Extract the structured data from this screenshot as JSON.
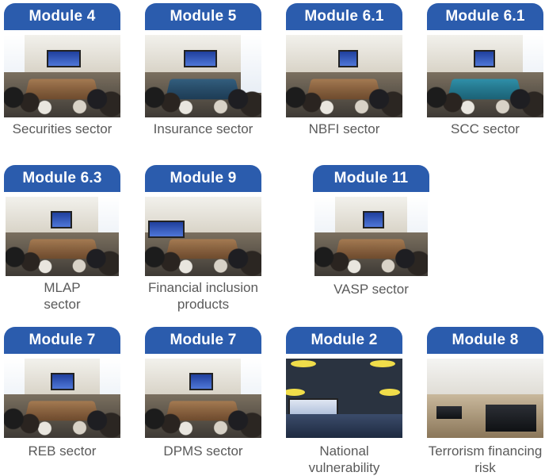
{
  "cards": [
    {
      "module": "Module 4",
      "caption": [
        "Securities sector"
      ]
    },
    {
      "module": "Module 5",
      "caption": [
        "Insurance sector"
      ]
    },
    {
      "module": "Module 6.1",
      "caption": [
        "NBFI sector"
      ]
    },
    {
      "module": "Module 6.1",
      "caption": [
        "SCC sector"
      ]
    },
    {
      "module": "Module 6.3",
      "caption": [
        "MLAP",
        "sector"
      ]
    },
    {
      "module": "Module 9",
      "caption": [
        "Financial inclusion",
        "products"
      ]
    },
    {
      "module": "Module 11",
      "caption": [
        "VASP sector"
      ]
    },
    {
      "module": "Module 7",
      "caption": [
        "REB sector"
      ]
    },
    {
      "module": "Module 7",
      "caption": [
        "DPMS sector"
      ]
    },
    {
      "module": "Module 2",
      "caption": [
        "National",
        "vulnerability"
      ]
    },
    {
      "module": "Module 8",
      "caption": [
        "Terrorism financing",
        "risk"
      ]
    }
  ],
  "colors": {
    "tab": "#2b5cad",
    "caption": "#5a5a5a"
  }
}
